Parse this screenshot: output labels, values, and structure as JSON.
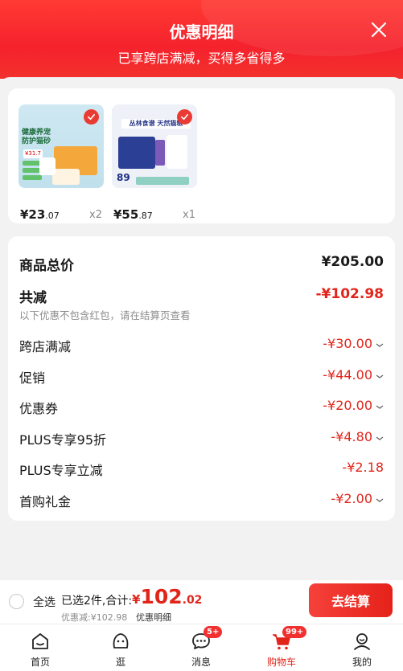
{
  "header": {
    "title": "优惠明细",
    "subtitle": "已享跨店满减，买得多省得多"
  },
  "products": [
    {
      "price_int": "¥23",
      "price_dec": ".07",
      "qty": "x2",
      "thumb_texts": [
        "健康养宠",
        "防护猫砂",
        "¥31.7"
      ]
    },
    {
      "price_int": "¥55",
      "price_dec": ".87",
      "qty": "x1",
      "thumb_texts": [
        "丛林食谱 天然猫粮",
        "89"
      ]
    }
  ],
  "detail": {
    "total_label": "商品总价",
    "total_value": "¥205.00",
    "reduce_label": "共减",
    "reduce_value": "-¥102.98",
    "note": "以下优惠不包含红包，请在结算页查看",
    "items": [
      {
        "label": "跨店满减",
        "value": "-¥30.00",
        "expandable": true
      },
      {
        "label": "促销",
        "value": "-¥44.00",
        "expandable": true
      },
      {
        "label": "优惠券",
        "value": "-¥20.00",
        "expandable": true
      },
      {
        "label": "PLUS专享95折",
        "value": "-¥4.80",
        "expandable": true
      },
      {
        "label": "PLUS专享立减",
        "value": "-¥2.18",
        "expandable": false
      },
      {
        "label": "首购礼金",
        "value": "-¥2.00",
        "expandable": true
      }
    ]
  },
  "footer": {
    "select_all": "全选",
    "selected_count": "已选2件,合计:",
    "total_currency": "¥",
    "total_int": "102",
    "total_dec": ".02",
    "discount_text": "优惠减:¥102.98",
    "detail_link": "优惠明细",
    "checkout": "去结算"
  },
  "tabbar": [
    {
      "label": "首页",
      "icon": "home-icon"
    },
    {
      "label": "逛",
      "icon": "browse-face-icon"
    },
    {
      "label": "消息",
      "icon": "message-icon",
      "badge": "5+"
    },
    {
      "label": "购物车",
      "icon": "cart-icon",
      "badge": "99+",
      "active": true
    },
    {
      "label": "我的",
      "icon": "profile-icon"
    }
  ],
  "colors": {
    "brand_red": "#e1251b",
    "header_red": "#f5222d"
  }
}
